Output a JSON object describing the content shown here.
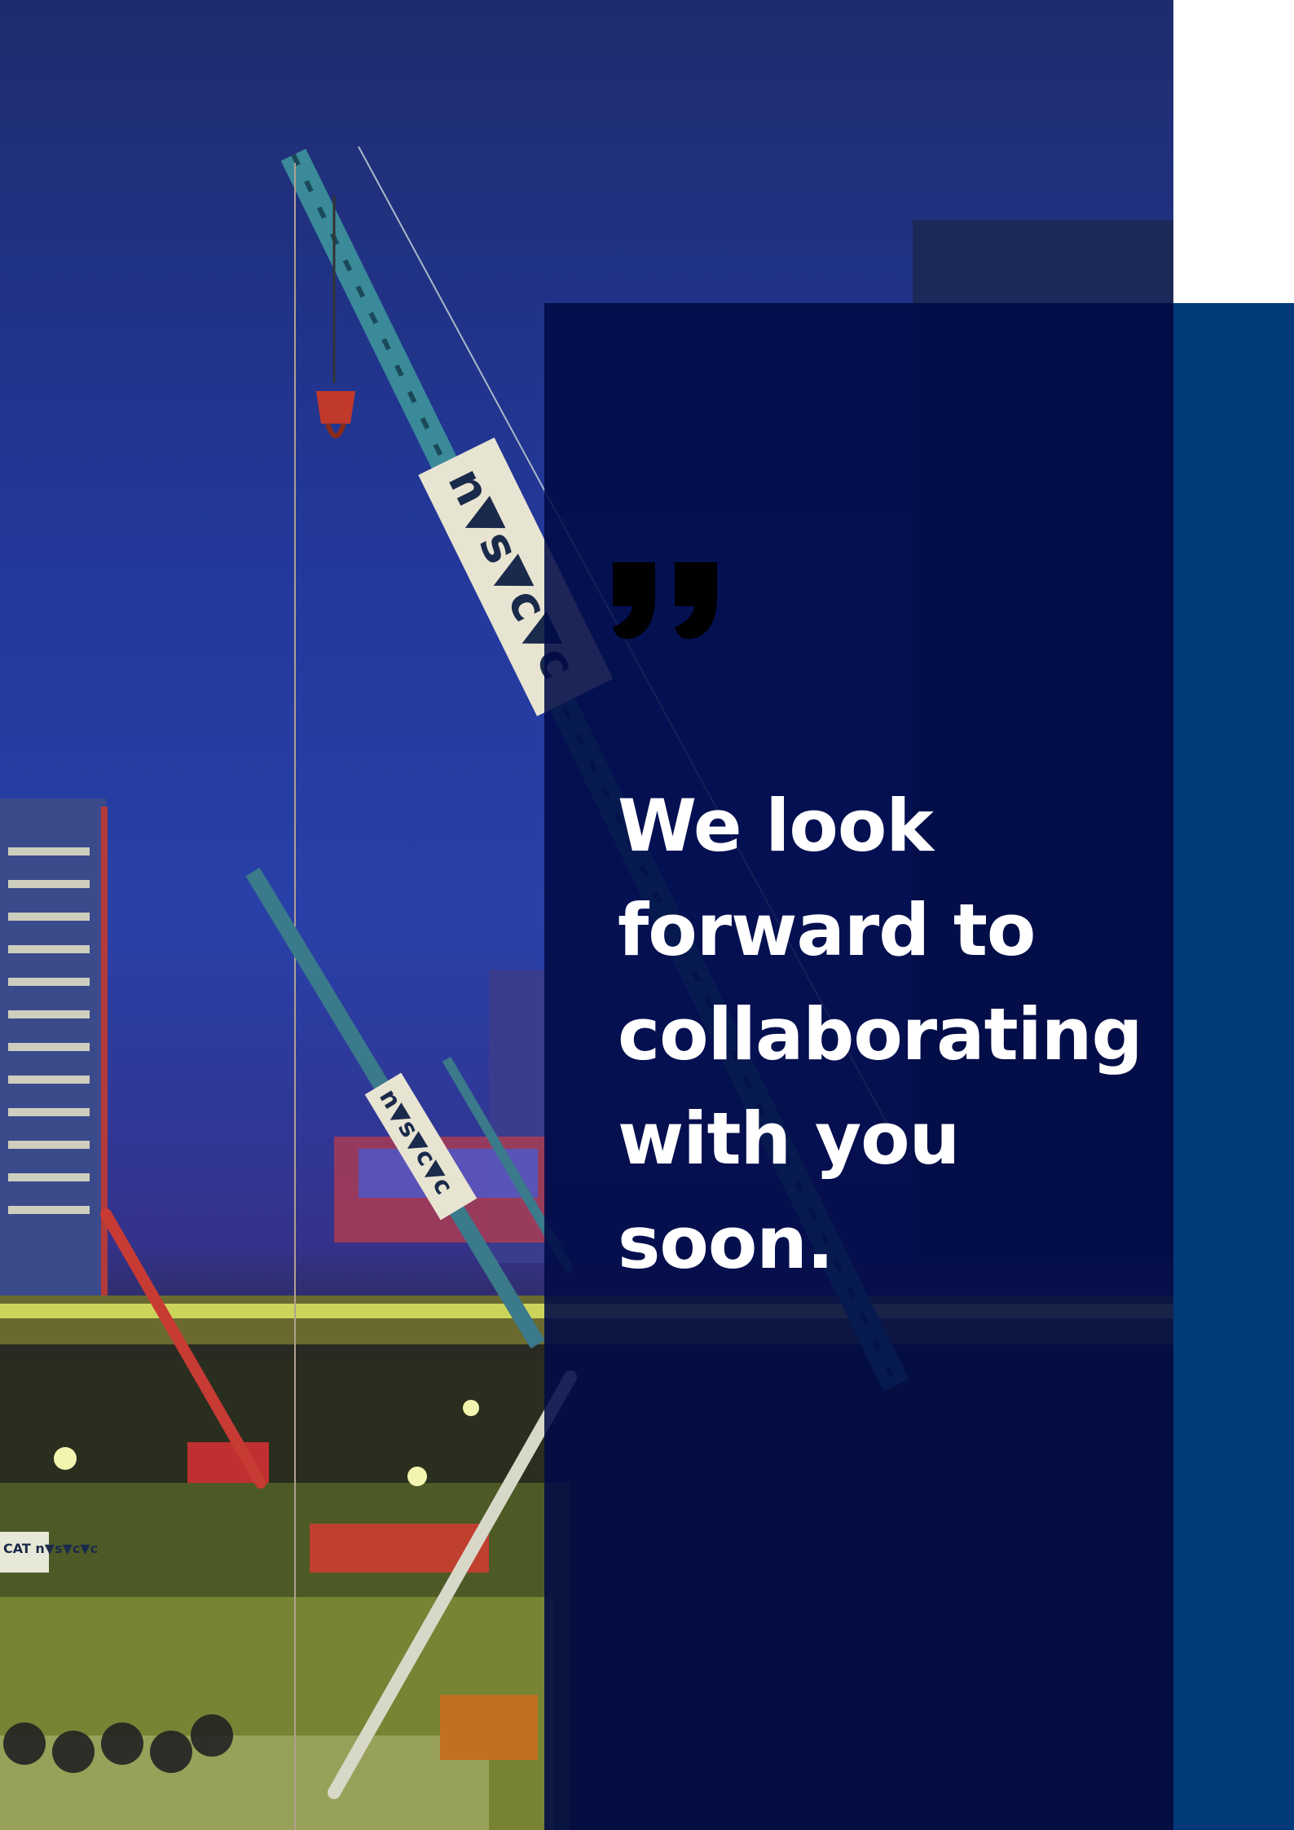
{
  "page": {
    "quote": "We look forward to collaborating with you soon.",
    "crane_banner_text": "n▼s▼c▼c",
    "equipment_sign_text": "CAT n▼s▼c▼c"
  },
  "colors": {
    "overlay": "#000a46",
    "right_band": "#003a78",
    "night_sky": "#2840a8",
    "text": "#ffffff"
  },
  "icons": {
    "quote_mark": "opening-quote-icon"
  }
}
